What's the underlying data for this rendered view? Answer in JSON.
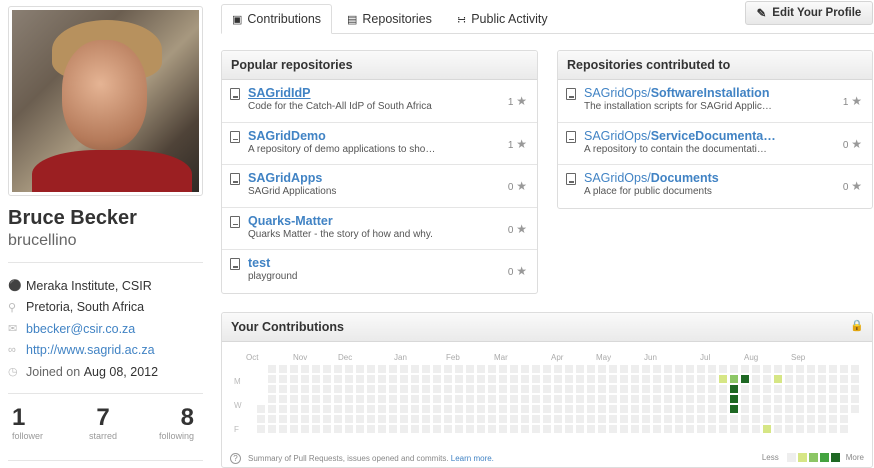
{
  "profile": {
    "fullname": "Bruce Becker",
    "username": "brucellino",
    "organization": "Meraka Institute, CSIR",
    "location": "Pretoria, South Africa",
    "email": "bbecker@csir.co.za",
    "website": "http://www.sagrid.ac.za",
    "joined_prefix": "Joined on ",
    "joined_date": "Aug 08, 2012",
    "stats": [
      {
        "value": "1",
        "label": "follower"
      },
      {
        "value": "7",
        "label": "starred"
      },
      {
        "value": "8",
        "label": "following"
      }
    ]
  },
  "tabs": [
    {
      "label": "Contributions",
      "icon": "contributions-icon"
    },
    {
      "label": "Repositories",
      "icon": "repo-icon"
    },
    {
      "label": "Public Activity",
      "icon": "rss-icon"
    }
  ],
  "edit_button": {
    "label": "Edit Your Profile",
    "icon": "pencil-icon"
  },
  "popular": {
    "title": "Popular repositories",
    "items": [
      {
        "name": "SAGridIdP",
        "desc": "Code for the Catch-All IdP of South Africa",
        "stars": "1"
      },
      {
        "name": "SAGridDemo",
        "desc": "A repository of demo applications to sho…",
        "stars": "1"
      },
      {
        "name": "SAGridApps",
        "desc": "SAGrid Applications",
        "stars": "0"
      },
      {
        "name": "Quarks-Matter",
        "desc": "Quarks Matter - the story of how and why.",
        "stars": "0"
      },
      {
        "name": "test",
        "desc": "playground",
        "stars": "0"
      }
    ]
  },
  "contributed": {
    "title": "Repositories contributed to",
    "items": [
      {
        "owner": "SAGridOps/",
        "name": "SoftwareInstallation",
        "desc": "The installation scripts for SAGrid Applic…",
        "stars": "1"
      },
      {
        "owner": "SAGridOps/",
        "name": "ServiceDocumenta…",
        "desc": "A repository to contain the documentati…",
        "stars": "0"
      },
      {
        "owner": "SAGridOps/",
        "name": "Documents",
        "desc": "A place for public documents",
        "stars": "0"
      }
    ]
  },
  "contributions": {
    "title": "Your Contributions",
    "months": [
      "Oct",
      "Nov",
      "Dec",
      "Jan",
      "Feb",
      "Mar",
      "Apr",
      "May",
      "Jun",
      "Jul",
      "Aug",
      "Sep"
    ],
    "days": [
      "M",
      "W",
      "F"
    ],
    "summary": "Summary of Pull Requests, issues opened and commits. ",
    "learn_more": "Learn more.",
    "legend_less": "Less",
    "legend_more": "More",
    "colors": [
      "#eeeeee",
      "#d6e685",
      "#8cc665",
      "#44a340",
      "#1e6823"
    ],
    "active_days": [
      {
        "week": 42,
        "day": 1,
        "level": 1
      },
      {
        "week": 43,
        "day": 1,
        "level": 2
      },
      {
        "week": 43,
        "day": 2,
        "level": 4
      },
      {
        "week": 43,
        "day": 3,
        "level": 4
      },
      {
        "week": 43,
        "day": 4,
        "level": 4
      },
      {
        "week": 44,
        "day": 1,
        "level": 4
      },
      {
        "week": 46,
        "day": 6,
        "level": 1
      },
      {
        "week": 47,
        "day": 1,
        "level": 1
      }
    ]
  }
}
